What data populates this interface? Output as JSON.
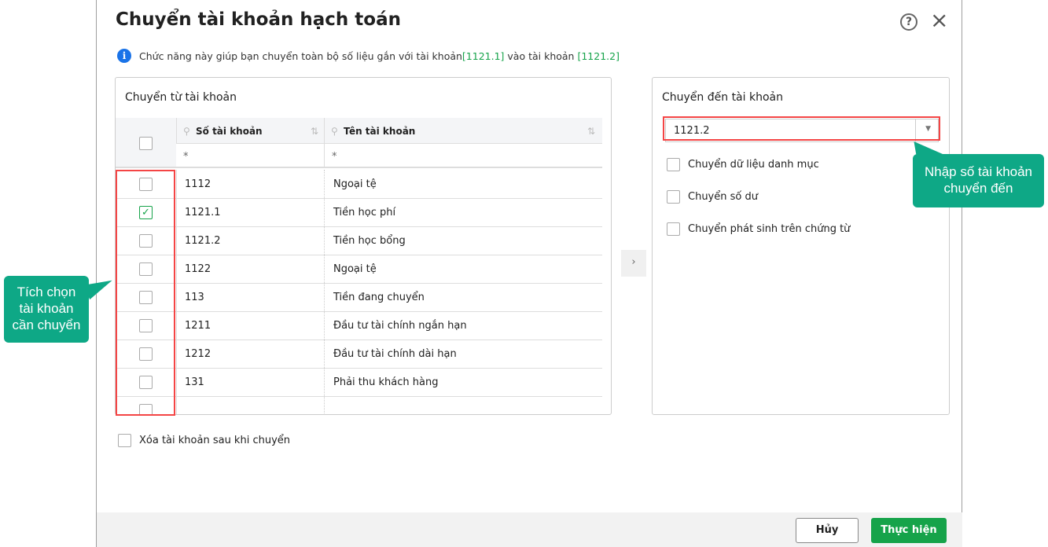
{
  "dialog": {
    "title": "Chuyển tài khoản hạch toán",
    "help_icon": "?",
    "close_icon": "×",
    "info": {
      "prefix": "Chức năng này giúp bạn chuyển toàn bộ số liệu gắn với tài khoản ",
      "from": "[1121.1]",
      "middle": " vào tài khoản ",
      "to": "[1121.2]"
    }
  },
  "left_panel": {
    "title": "Chuyển từ tài khoản",
    "columns": [
      "Số tài khoản",
      "Tên tài khoản"
    ],
    "filter": "*",
    "rows": [
      {
        "code": "1112",
        "name": "Ngoại tệ",
        "checked": false
      },
      {
        "code": "1121.1",
        "name": "Tiền học phí",
        "checked": true
      },
      {
        "code": "1121.2",
        "name": "Tiền học bổng",
        "checked": false
      },
      {
        "code": "1122",
        "name": "Ngoại tệ",
        "checked": false
      },
      {
        "code": "113",
        "name": "Tiền đang chuyển",
        "checked": false
      },
      {
        "code": "1211",
        "name": "Đầu tư tài chính ngắn hạn",
        "checked": false
      },
      {
        "code": "1212",
        "name": "Đầu tư tài chính dài hạn",
        "checked": false
      },
      {
        "code": "131",
        "name": "Phải thu khách hàng",
        "checked": false
      }
    ]
  },
  "right_panel": {
    "title": "Chuyển đến tài khoản",
    "account_value": "1121.2",
    "options": [
      "Chuyển dữ liệu danh mục",
      "Chuyển số dư",
      "Chuyển phát sinh trên chứng từ"
    ]
  },
  "delete_after": "Xóa tài khoản sau khi chuyển",
  "buttons": {
    "cancel": "Hủy",
    "submit": "Thực hiện"
  },
  "callouts": {
    "left": "Tích chọn tài khoản cần chuyển",
    "right": "Nhập số tài khoản chuyển đến"
  }
}
